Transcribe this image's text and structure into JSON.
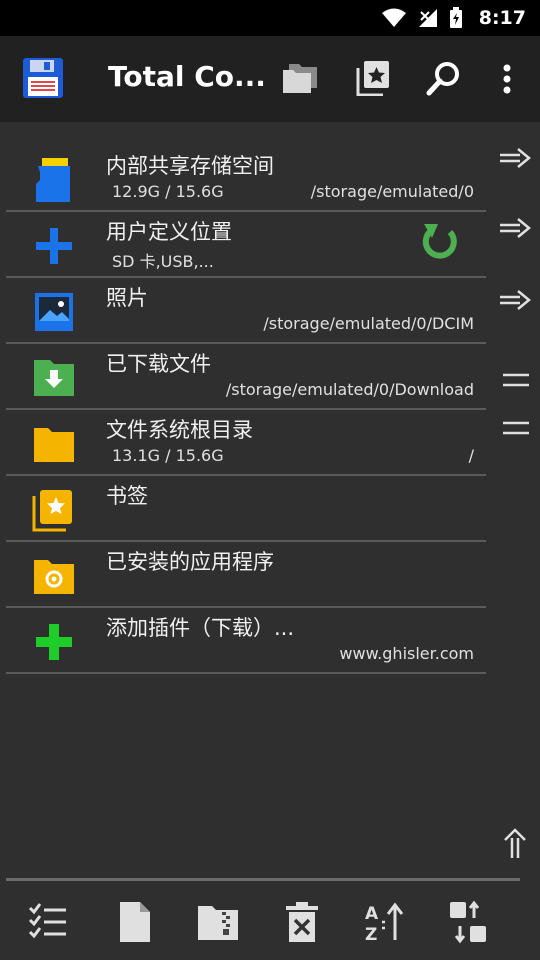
{
  "status": {
    "time": "8:17"
  },
  "toolbar": {
    "title": "Total Co..."
  },
  "rows": [
    {
      "name": "内部共享存储空间",
      "sub": "12.9G / 15.6G",
      "path": "/storage/emulated/0",
      "side": "arrow"
    },
    {
      "name": "用户定义位置",
      "sub": "SD 卡,USB,...",
      "path": "",
      "side": "arrow"
    },
    {
      "name": "照片",
      "sub": "",
      "path": "/storage/emulated/0/DCIM",
      "side": "arrow"
    },
    {
      "name": "已下载文件",
      "sub": "",
      "path": "/storage/emulated/0/Download",
      "side": "equals"
    },
    {
      "name": "文件系统根目录",
      "sub": "13.1G / 15.6G",
      "path": "/",
      "side": "equals"
    },
    {
      "name": "书签",
      "sub": "",
      "path": "",
      "side": ""
    },
    {
      "name": "已安装的应用程序",
      "sub": "",
      "path": "",
      "side": ""
    },
    {
      "name": "添加插件（下载）...",
      "sub": "",
      "path": "www.ghisler.com",
      "side": ""
    }
  ],
  "icons": {
    "toolbar": [
      "save-disk-icon",
      "folders-icon",
      "bookmark-star-icon",
      "search-icon",
      "more-vert-icon"
    ],
    "rows": [
      "sd-card-icon",
      "plus-icon",
      "photo-icon",
      "download-folder-icon",
      "folder-icon",
      "bookmarks-icon",
      "app-folder-icon",
      "plugin-plus-icon"
    ],
    "bottom": [
      "select-list-icon",
      "new-file-icon",
      "zip-folder-icon",
      "delete-icon",
      "sort-az-icon",
      "swap-panels-icon"
    ]
  },
  "colors": {
    "background": "#2f2f2f",
    "toolbar": "#212121",
    "accent_green": "#4caf50",
    "folder_yellow": "#f5b400"
  }
}
